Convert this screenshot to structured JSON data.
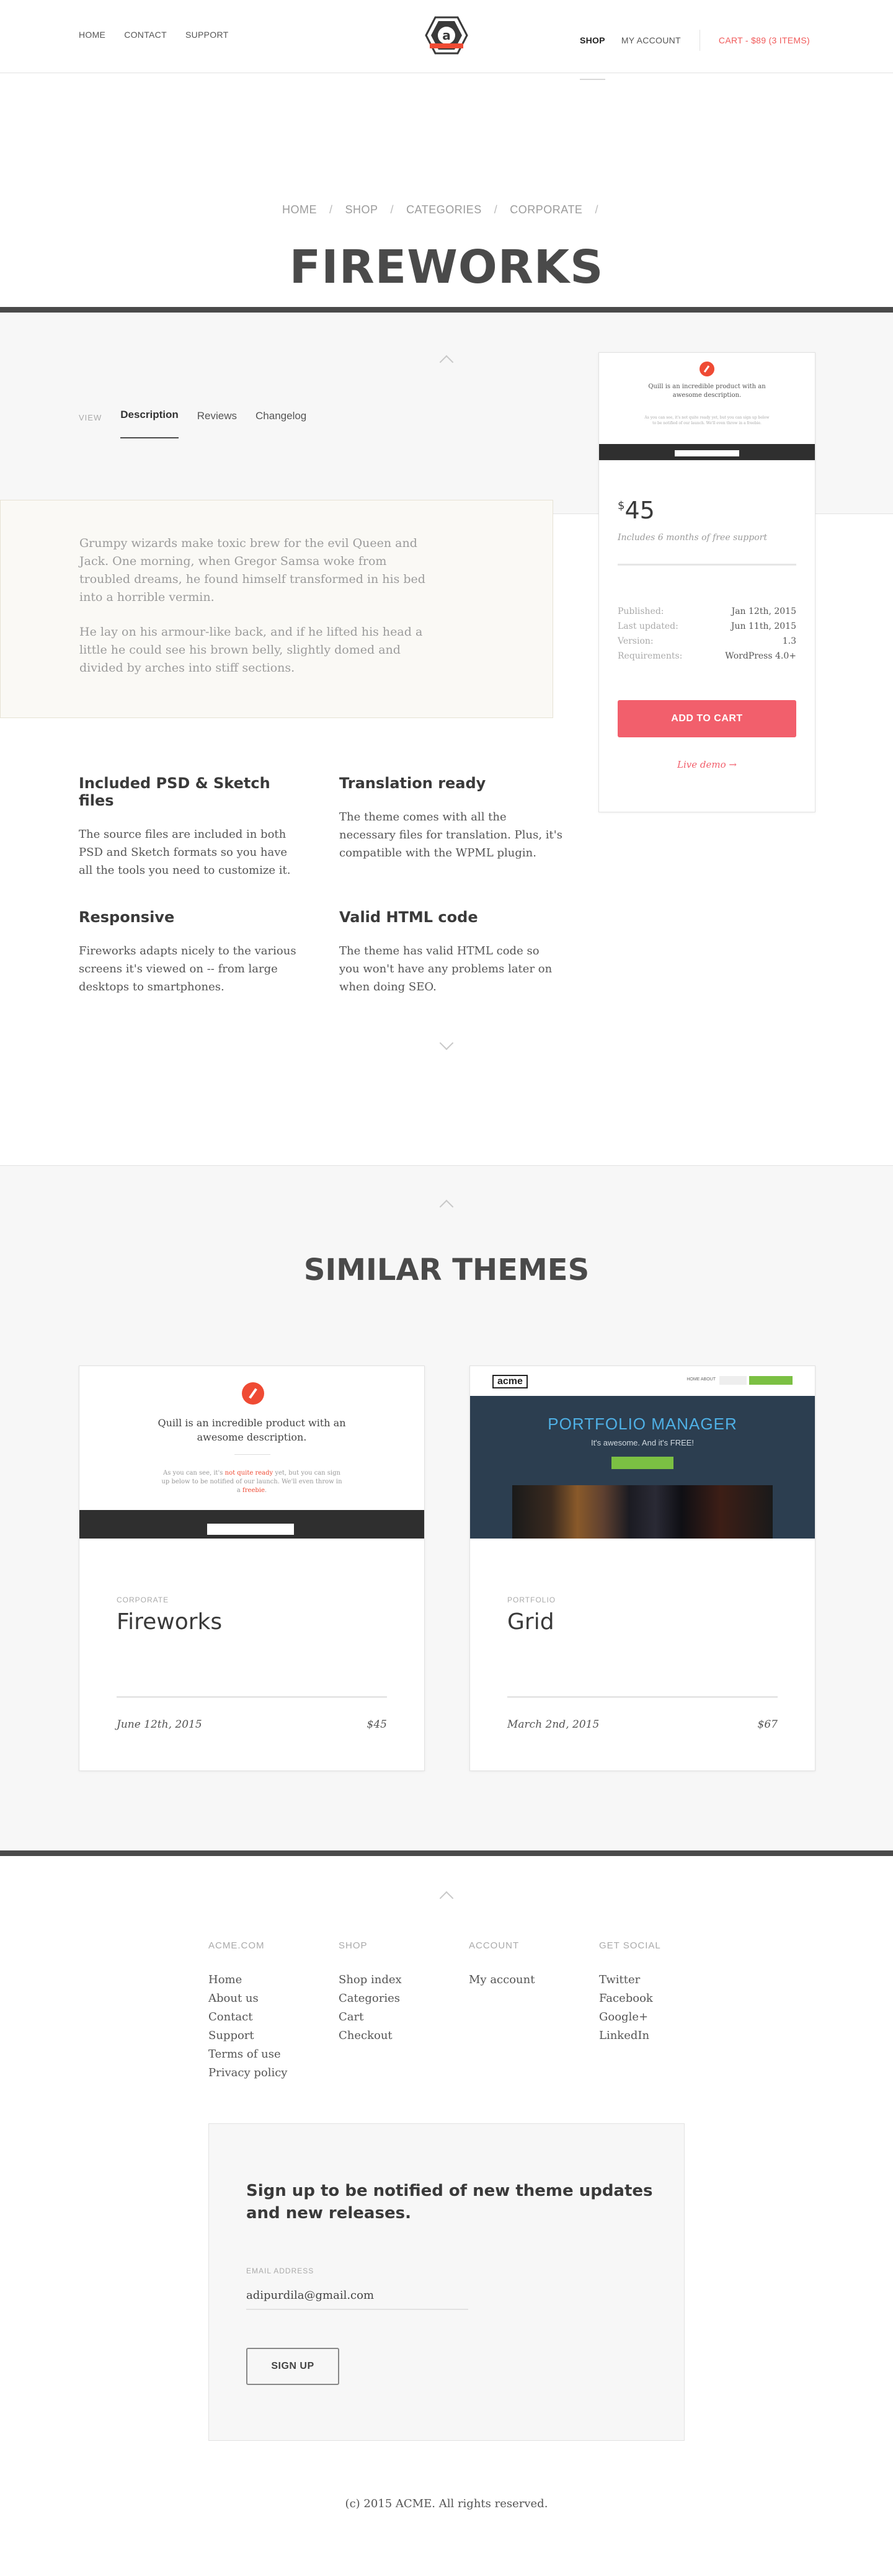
{
  "nav": {
    "left": [
      "HOME",
      "CONTACT",
      "SUPPORT"
    ],
    "shop": "SHOP",
    "account": "MY ACCOUNT",
    "cart": "CART - $89 (3 ITEMS)"
  },
  "logo": {
    "letter": "a"
  },
  "breadcrumb": [
    "HOME",
    "SHOP",
    "CATEGORIES",
    "CORPORATE"
  ],
  "page_title": "FIREWORKS",
  "tabs": {
    "view_label": "VIEW",
    "items": [
      "Description",
      "Reviews",
      "Changelog"
    ]
  },
  "description": {
    "p1": "Grumpy wizards make toxic brew for the evil Queen and Jack. One morning, when Gregor Samsa woke from troubled dreams, he found himself transformed in his bed into a horrible vermin.",
    "p2": "He lay on his armour-like back, and if he lifted his head a little he could see his brown belly, slightly domed and divided by arches into stiff sections."
  },
  "features": [
    {
      "title": "Included PSD & Sketch files",
      "text": "The source files are included in both PSD and Sketch formats so you have all the tools you need to customize it."
    },
    {
      "title": "Translation ready",
      "text": "The theme comes with all the necessary files for translation. Plus, it's compatible with the WPML plugin."
    },
    {
      "title": "Responsive",
      "text": "Fireworks adapts nicely to the various screens it's viewed on -- from large desktops to smartphones."
    },
    {
      "title": "Valid HTML code",
      "text": "The theme has valid HTML code so you won't have any problems later on when doing SEO."
    }
  ],
  "product": {
    "thumb_title": "Quill is an incredible product with an awesome description.",
    "thumb_sub": "As you can see, it's not quite ready yet, but you can sign up below to be notified of our launch. We'll even throw in a freebie.",
    "currency": "$",
    "price": "45",
    "support": "Includes 6 months of free support",
    "meta": [
      {
        "k": "Published:",
        "v": "Jan 12th, 2015"
      },
      {
        "k": "Last updated:",
        "v": "Jun 11th, 2015"
      },
      {
        "k": "Version:",
        "v": "1.3"
      },
      {
        "k": "Requirements:",
        "v": "WordPress 4.0+"
      }
    ],
    "add_to_cart": "ADD TO CART",
    "live_demo": "Live demo →"
  },
  "similar": {
    "title": "SIMILAR THEMES",
    "cards": [
      {
        "category": "CORPORATE",
        "name": "Fireworks",
        "date": "June 12th, 2015",
        "price": "$45",
        "shot_title": "Quill is an incredible product with an awesome description.",
        "shot_sub_a": "As you can see, it's ",
        "shot_sub_b": "not quite ready",
        "shot_sub_c": " yet, but you can sign up below to be notified of our launch. We'll even throw in a ",
        "shot_sub_d": "freebie",
        "shot_sub_e": "."
      },
      {
        "category": "PORTFOLIO",
        "name": "Grid",
        "date": "March 2nd, 2015",
        "price": "$67",
        "shot_logo": "acme",
        "shot_menu": "HOME   ABOUT",
        "shot_heading": "PORTFOLIO MANAGER",
        "shot_sub": "It's awesome. And it's FREE!"
      }
    ]
  },
  "footer": {
    "columns": [
      {
        "title": "ACME.COM",
        "links": [
          "Home",
          "About us",
          "Contact",
          "Support",
          "Terms of use",
          "Privacy policy"
        ]
      },
      {
        "title": "SHOP",
        "links": [
          "Shop index",
          "Categories",
          "Cart",
          "Checkout"
        ]
      },
      {
        "title": "ACCOUNT",
        "links": [
          "My account"
        ]
      },
      {
        "title": "GET SOCIAL",
        "links": [
          "Twitter",
          "Facebook",
          "Google+",
          "LinkedIn"
        ]
      }
    ],
    "signup_heading": "Sign up to be notified of new theme updates and new releases.",
    "email_label": "EMAIL ADDRESS",
    "email_value": "adipurdila@gmail.com",
    "signup_button": "SIGN UP",
    "copyright": "(c) 2015 ACME. All rights reserved."
  },
  "colors": {
    "accent": "#f25f6c",
    "dark": "#4a4a4a",
    "band": "#f7f7f7"
  }
}
